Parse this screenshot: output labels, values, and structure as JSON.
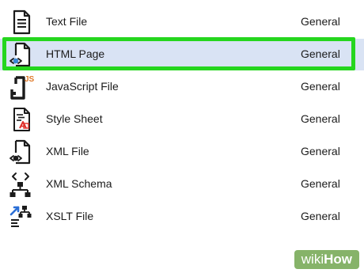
{
  "items": [
    {
      "name": "Text File",
      "category": "General",
      "icon": "text-file-icon"
    },
    {
      "name": "HTML Page",
      "category": "General",
      "icon": "html-page-icon",
      "selected": true
    },
    {
      "name": "JavaScript File",
      "category": "General",
      "icon": "javascript-file-icon",
      "badge": "JS"
    },
    {
      "name": "Style Sheet",
      "category": "General",
      "icon": "style-sheet-icon"
    },
    {
      "name": "XML File",
      "category": "General",
      "icon": "xml-file-icon"
    },
    {
      "name": "XML Schema",
      "category": "General",
      "icon": "xml-schema-icon"
    },
    {
      "name": "XSLT File",
      "category": "General",
      "icon": "xslt-file-icon"
    }
  ],
  "colors": {
    "selection_background": "#d9e3f4",
    "highlight_outline": "#25d61e",
    "watermark_background": "#6ba248",
    "js_badge": "#e07a2a",
    "xslt_arrow": "#2b6fd6",
    "style_sheet_accent": "#e0302b",
    "web_icon_blue": "#3a86d4"
  },
  "watermark": {
    "wiki": "wiki",
    "how": "How"
  }
}
